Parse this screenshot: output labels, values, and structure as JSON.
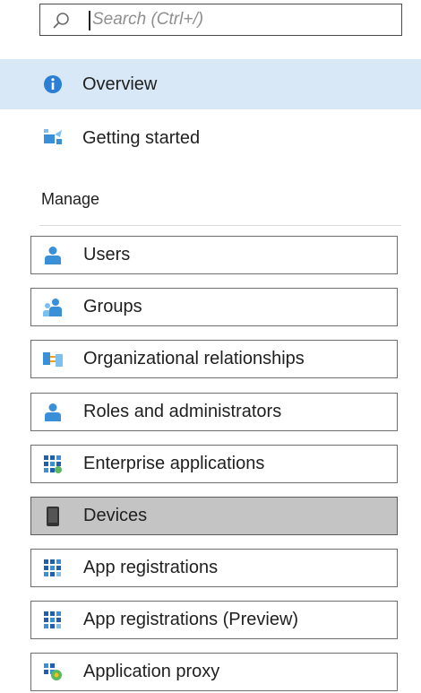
{
  "search": {
    "placeholder": "Search (Ctrl+/)"
  },
  "top_items": [
    {
      "label": "Overview",
      "icon": "info-icon",
      "selected": true
    },
    {
      "label": "Getting started",
      "icon": "rocket-icon",
      "selected": false
    }
  ],
  "manage": {
    "heading": "Manage",
    "items": [
      {
        "label": "Users",
        "icon": "user-icon"
      },
      {
        "label": "Groups",
        "icon": "group-icon"
      },
      {
        "label": "Organizational relationships",
        "icon": "org-relationships-icon"
      },
      {
        "label": "Roles and administrators",
        "icon": "user-icon"
      },
      {
        "label": "Enterprise applications",
        "icon": "enterprise-apps-icon"
      },
      {
        "label": "Devices",
        "icon": "device-icon",
        "selected": true
      },
      {
        "label": "App registrations",
        "icon": "app-grid-icon"
      },
      {
        "label": "App registrations (Preview)",
        "icon": "app-grid-icon"
      },
      {
        "label": "Application proxy",
        "icon": "app-proxy-icon"
      }
    ]
  },
  "colors": {
    "selected_top": "#d8e8f7",
    "selected_item": "#c4c4c4",
    "accent_blue": "#0078d4"
  }
}
